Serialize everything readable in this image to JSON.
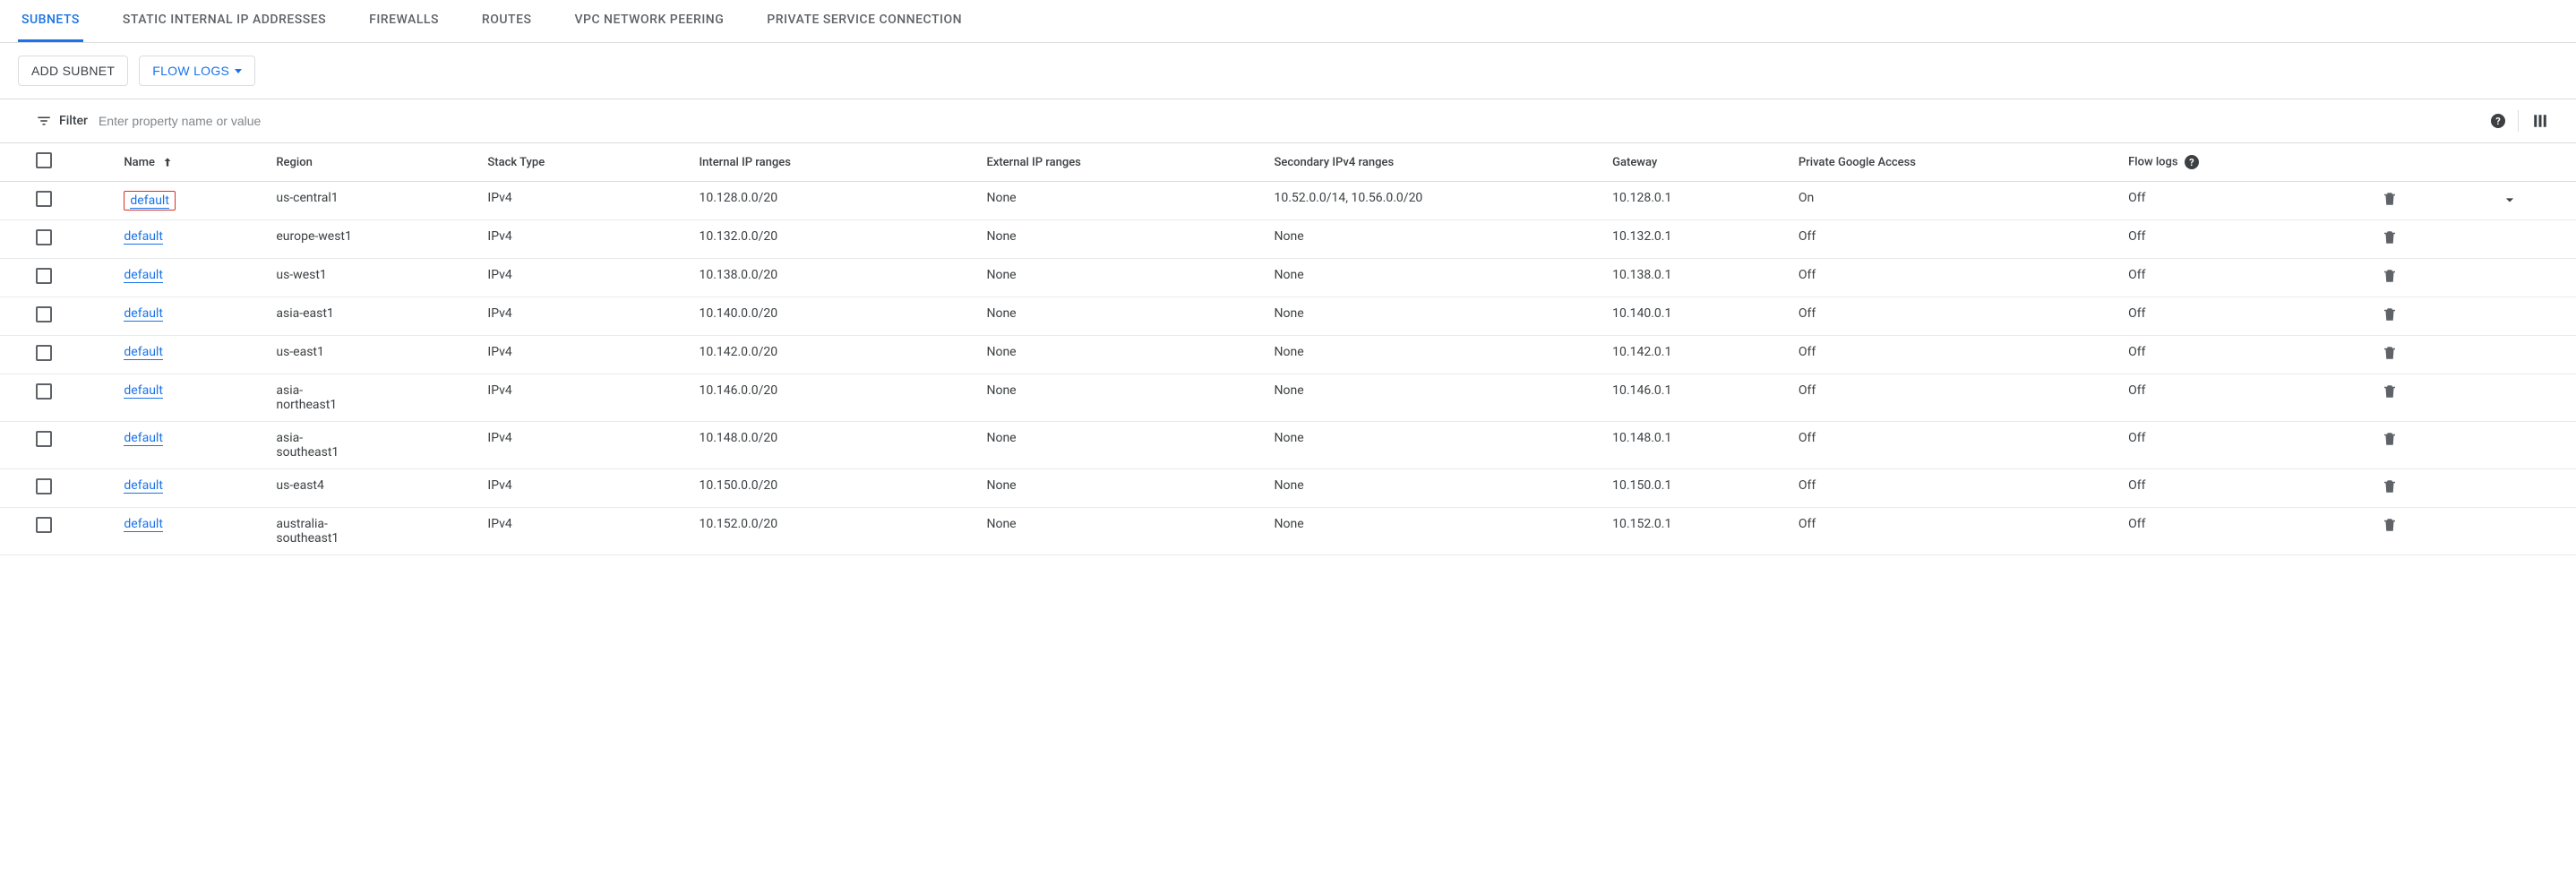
{
  "tabs": {
    "subnets": "SUBNETS",
    "static_ips": "STATIC INTERNAL IP ADDRESSES",
    "firewalls": "FIREWALLS",
    "routes": "ROUTES",
    "peering": "VPC NETWORK PEERING",
    "psc": "PRIVATE SERVICE CONNECTION"
  },
  "actions": {
    "add_subnet": "ADD SUBNET",
    "flow_logs": "FLOW LOGS"
  },
  "filter": {
    "label": "Filter",
    "placeholder": "Enter property name or value"
  },
  "columns": {
    "name": "Name",
    "region": "Region",
    "stack_type": "Stack Type",
    "internal_ip": "Internal IP ranges",
    "external_ip": "External IP ranges",
    "secondary": "Secondary IPv4 ranges",
    "gateway": "Gateway",
    "pga": "Private Google Access",
    "flow_logs": "Flow logs"
  },
  "rows": [
    {
      "name": "default",
      "region": "us-central1",
      "stack": "IPv4",
      "internal": "10.128.0.0/20",
      "external": "None",
      "secondary": "10.52.0.0/14, 10.56.0.0/20",
      "gateway": "10.128.0.1",
      "pga": "On",
      "flow": "Off",
      "highlighted": true,
      "expandable": true
    },
    {
      "name": "default",
      "region": "europe-west1",
      "stack": "IPv4",
      "internal": "10.132.0.0/20",
      "external": "None",
      "secondary": "None",
      "gateway": "10.132.0.1",
      "pga": "Off",
      "flow": "Off"
    },
    {
      "name": "default",
      "region": "us-west1",
      "stack": "IPv4",
      "internal": "10.138.0.0/20",
      "external": "None",
      "secondary": "None",
      "gateway": "10.138.0.1",
      "pga": "Off",
      "flow": "Off"
    },
    {
      "name": "default",
      "region": "asia-east1",
      "stack": "IPv4",
      "internal": "10.140.0.0/20",
      "external": "None",
      "secondary": "None",
      "gateway": "10.140.0.1",
      "pga": "Off",
      "flow": "Off"
    },
    {
      "name": "default",
      "region": "us-east1",
      "stack": "IPv4",
      "internal": "10.142.0.0/20",
      "external": "None",
      "secondary": "None",
      "gateway": "10.142.0.1",
      "pga": "Off",
      "flow": "Off"
    },
    {
      "name": "default",
      "region": "asia-northeast1",
      "stack": "IPv4",
      "internal": "10.146.0.0/20",
      "external": "None",
      "secondary": "None",
      "gateway": "10.146.0.1",
      "pga": "Off",
      "flow": "Off"
    },
    {
      "name": "default",
      "region": "asia-southeast1",
      "stack": "IPv4",
      "internal": "10.148.0.0/20",
      "external": "None",
      "secondary": "None",
      "gateway": "10.148.0.1",
      "pga": "Off",
      "flow": "Off"
    },
    {
      "name": "default",
      "region": "us-east4",
      "stack": "IPv4",
      "internal": "10.150.0.0/20",
      "external": "None",
      "secondary": "None",
      "gateway": "10.150.0.1",
      "pga": "Off",
      "flow": "Off"
    },
    {
      "name": "default",
      "region": "australia-southeast1",
      "stack": "IPv4",
      "internal": "10.152.0.0/20",
      "external": "None",
      "secondary": "None",
      "gateway": "10.152.0.1",
      "pga": "Off",
      "flow": "Off"
    }
  ]
}
